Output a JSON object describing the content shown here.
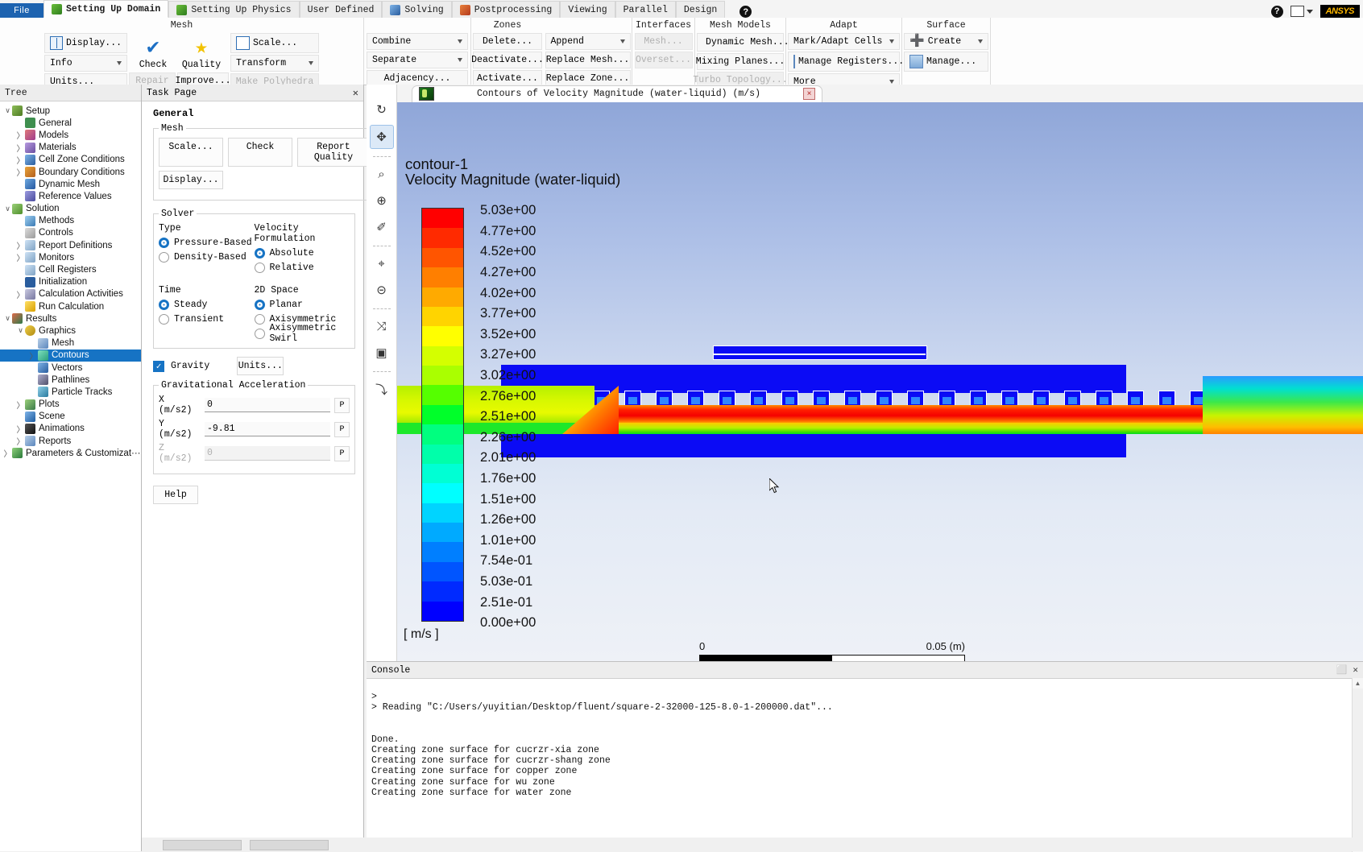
{
  "window": {
    "file_menu": "File",
    "tabs": [
      {
        "label": "Setting Up Domain",
        "icon": "green-mesh-icon",
        "active": true
      },
      {
        "label": "Setting Up Physics",
        "icon": "green-physics-icon",
        "active": false
      },
      {
        "label": "User Defined",
        "icon": "none",
        "active": false
      },
      {
        "label": "Solving",
        "icon": "blue-solver-icon",
        "active": false
      },
      {
        "label": "Postprocessing",
        "icon": "red-post-icon",
        "active": false
      },
      {
        "label": "Viewing",
        "icon": "none",
        "active": false
      },
      {
        "label": "Parallel",
        "icon": "none",
        "active": false
      },
      {
        "label": "Design",
        "icon": "none",
        "active": false
      }
    ],
    "help_label": "?",
    "brand": "ANSYS"
  },
  "ribbon": {
    "groups": [
      {
        "title": "Mesh",
        "items": [
          {
            "label": "Display...",
            "icon": "grid-icon",
            "disabled": false,
            "dropdown": false
          },
          {
            "label": "Info",
            "icon": "none",
            "disabled": false,
            "dropdown": true
          },
          {
            "label": "Units...",
            "icon": "none",
            "disabled": false,
            "dropdown": false
          },
          {
            "label": "Check",
            "icon": "blue-check-icon",
            "disabled": false,
            "big": true
          },
          {
            "label": "Repair",
            "icon": "none",
            "disabled": true,
            "dropdown": false
          },
          {
            "label": "Quality",
            "icon": "gold-star-icon",
            "disabled": false,
            "big": true
          },
          {
            "label": "Improve...",
            "icon": "none",
            "disabled": false,
            "dropdown": false
          },
          {
            "label": "Scale...",
            "icon": "scale-icon",
            "disabled": false,
            "dropdown": false
          },
          {
            "label": "Transform",
            "icon": "none",
            "disabled": false,
            "dropdown": true
          },
          {
            "label": "Make Polyhedra",
            "icon": "none",
            "disabled": true,
            "dropdown": false
          }
        ]
      },
      {
        "title": "Zones",
        "items": [
          {
            "label": "Combine",
            "icon": "none",
            "disabled": false,
            "dropdown": true
          },
          {
            "label": "Separate",
            "icon": "none",
            "disabled": false,
            "dropdown": true
          },
          {
            "label": "Adjacency...",
            "icon": "none",
            "disabled": false,
            "dropdown": false
          },
          {
            "label": "Delete...",
            "icon": "none",
            "disabled": false,
            "dropdown": false
          },
          {
            "label": "Deactivate...",
            "icon": "none",
            "disabled": false,
            "dropdown": false
          },
          {
            "label": "Activate...",
            "icon": "none",
            "disabled": false,
            "dropdown": false
          },
          {
            "label": "Append",
            "icon": "none",
            "disabled": false,
            "dropdown": true
          },
          {
            "label": "Replace Mesh...",
            "icon": "none",
            "disabled": false,
            "dropdown": false
          },
          {
            "label": "Replace Zone...",
            "icon": "none",
            "disabled": false,
            "dropdown": false
          }
        ]
      },
      {
        "title": "Interfaces",
        "items": [
          {
            "label": "Mesh...",
            "icon": "none",
            "disabled": true,
            "dropdown": false
          },
          {
            "label": "Overset...",
            "icon": "none",
            "disabled": true,
            "dropdown": false
          }
        ]
      },
      {
        "title": "Mesh Models",
        "items": [
          {
            "label": "Dynamic Mesh...",
            "icon": "dynamic-mesh-icon",
            "disabled": false,
            "dropdown": false
          },
          {
            "label": "Mixing Planes...",
            "icon": "none",
            "disabled": false,
            "dropdown": false
          },
          {
            "label": "Turbo Topology...",
            "icon": "none",
            "disabled": true,
            "dropdown": false
          }
        ]
      },
      {
        "title": "Adapt",
        "items": [
          {
            "label": "Mark/Adapt Cells",
            "icon": "none",
            "disabled": false,
            "dropdown": true
          },
          {
            "label": "Manage Registers...",
            "icon": "register-icon",
            "disabled": false,
            "dropdown": false
          },
          {
            "label": "More",
            "icon": "none",
            "disabled": false,
            "dropdown": true
          }
        ]
      },
      {
        "title": "Surface",
        "items": [
          {
            "label": "Create",
            "icon": "plus-icon",
            "disabled": false,
            "dropdown": true
          },
          {
            "label": "Manage...",
            "icon": "register-icon",
            "disabled": false,
            "dropdown": false
          }
        ]
      }
    ]
  },
  "tree": {
    "header": "Tree",
    "items": [
      {
        "label": "Setup",
        "indent": 0,
        "arrow": "down",
        "icon": "c-setup"
      },
      {
        "label": "General",
        "indent": 1,
        "arrow": "none",
        "icon": "c-general"
      },
      {
        "label": "Models",
        "indent": 1,
        "arrow": "right",
        "icon": "c-models"
      },
      {
        "label": "Materials",
        "indent": 1,
        "arrow": "right",
        "icon": "c-materials"
      },
      {
        "label": "Cell Zone Conditions",
        "indent": 1,
        "arrow": "right",
        "icon": "c-czc"
      },
      {
        "label": "Boundary Conditions",
        "indent": 1,
        "arrow": "right",
        "icon": "c-bc"
      },
      {
        "label": "Dynamic Mesh",
        "indent": 1,
        "arrow": "none",
        "icon": "c-dyn"
      },
      {
        "label": "Reference Values",
        "indent": 1,
        "arrow": "none",
        "icon": "c-ref"
      },
      {
        "label": "Solution",
        "indent": 0,
        "arrow": "down",
        "icon": "c-solution"
      },
      {
        "label": "Methods",
        "indent": 1,
        "arrow": "none",
        "icon": "c-methods"
      },
      {
        "label": "Controls",
        "indent": 1,
        "arrow": "none",
        "icon": "c-controls"
      },
      {
        "label": "Report Definitions",
        "indent": 1,
        "arrow": "right",
        "icon": "c-report"
      },
      {
        "label": "Monitors",
        "indent": 1,
        "arrow": "right",
        "icon": "c-report"
      },
      {
        "label": "Cell Registers",
        "indent": 1,
        "arrow": "none",
        "icon": "c-report"
      },
      {
        "label": "Initialization",
        "indent": 1,
        "arrow": "none",
        "icon": "c-init"
      },
      {
        "label": "Calculation Activities",
        "indent": 1,
        "arrow": "right",
        "icon": "c-calc"
      },
      {
        "label": "Run Calculation",
        "indent": 1,
        "arrow": "none",
        "icon": "c-run"
      },
      {
        "label": "Results",
        "indent": 0,
        "arrow": "down",
        "icon": "c-results"
      },
      {
        "label": "Graphics",
        "indent": 1,
        "arrow": "down",
        "icon": "c-graphics"
      },
      {
        "label": "Mesh",
        "indent": 2,
        "arrow": "none",
        "icon": "c-mesh"
      },
      {
        "label": "Contours",
        "indent": 2,
        "arrow": "right",
        "icon": "c-contours",
        "selected": true
      },
      {
        "label": "Vectors",
        "indent": 2,
        "arrow": "none",
        "icon": "c-vectors"
      },
      {
        "label": "Pathlines",
        "indent": 2,
        "arrow": "none",
        "icon": "c-path"
      },
      {
        "label": "Particle Tracks",
        "indent": 2,
        "arrow": "none",
        "icon": "c-part"
      },
      {
        "label": "Plots",
        "indent": 1,
        "arrow": "right",
        "icon": "c-plots"
      },
      {
        "label": "Scene",
        "indent": 1,
        "arrow": "none",
        "icon": "c-scene"
      },
      {
        "label": "Animations",
        "indent": 1,
        "arrow": "right",
        "icon": "c-anim"
      },
      {
        "label": "Reports",
        "indent": 1,
        "arrow": "right",
        "icon": "c-reports"
      },
      {
        "label": "Parameters & Customizat···",
        "indent": 0,
        "arrow": "right",
        "icon": "c-param"
      }
    ]
  },
  "task_page": {
    "header": "Task Page",
    "title": "General",
    "mesh_group": {
      "legend": "Mesh",
      "scale": "Scale...",
      "check": "Check",
      "report_quality": "Report Quality",
      "display": "Display..."
    },
    "solver_group": {
      "legend": "Solver",
      "type_label": "Type",
      "type_options": [
        "Pressure-Based",
        "Density-Based"
      ],
      "type_selected": "Pressure-Based",
      "velocity_label": "Velocity Formulation",
      "velocity_options": [
        "Absolute",
        "Relative"
      ],
      "velocity_selected": "Absolute",
      "time_label": "Time",
      "time_options": [
        "Steady",
        "Transient"
      ],
      "time_selected": "Steady",
      "space_label": "2D Space",
      "space_options": [
        "Planar",
        "Axisymmetric",
        "Axisymmetric Swirl"
      ],
      "space_selected": "Planar"
    },
    "gravity": {
      "label": "Gravity",
      "checked": true,
      "units_button": "Units...",
      "accel_legend": "Gravitational Acceleration",
      "rows": [
        {
          "label": "X (m/s2)",
          "value": "0",
          "disabled": false,
          "p": "P"
        },
        {
          "label": "Y (m/s2)",
          "value": "-9.81",
          "disabled": false,
          "p": "P"
        },
        {
          "label": "Z (m/s2)",
          "value": "0",
          "disabled": true,
          "p": "P"
        }
      ]
    },
    "help_button": "Help"
  },
  "graphics_toolbar": {
    "icons": [
      {
        "name": "refresh-icon",
        "glyph": "↻",
        "active": false
      },
      {
        "name": "pan-move-icon",
        "glyph": "✥",
        "active": true
      },
      {
        "name": "zoom-fit-icon",
        "glyph": "⌕",
        "active": false
      },
      {
        "name": "zoom-in-icon",
        "glyph": "⊕",
        "active": false
      },
      {
        "name": "probe-icon",
        "glyph": "✐",
        "active": false
      },
      {
        "name": "zoom-region-icon",
        "glyph": "⌖",
        "active": false
      },
      {
        "name": "zoom-out-icon",
        "glyph": "⊝",
        "active": false
      },
      {
        "name": "mesh-display-icon",
        "glyph": "⤨",
        "active": false
      },
      {
        "name": "camera-icon",
        "glyph": "▣",
        "active": false
      },
      {
        "name": "axes-icon",
        "glyph": "⤵",
        "active": false
      }
    ]
  },
  "graphics_window": {
    "tab_title": "Contours of Velocity Magnitude  (water-liquid)  (m/s)",
    "close_label": "×",
    "overlay_title": "contour-1",
    "overlay_subtitle": "Velocity Magnitude (water-liquid)",
    "unit_label": "[ m/s ]",
    "scale": {
      "left": "0",
      "right": "0.05 (m)",
      "filled_fraction": 0.5
    }
  },
  "chart_data": {
    "type": "heatmap",
    "title": "Contours of Velocity Magnitude (water-liquid) (m/s)",
    "subtitle": "contour-1 / Velocity Magnitude (water-liquid)",
    "units": "[ m/s ]",
    "colormap": "rainbow-jet",
    "legend_position": "left",
    "value_range": [
      0.0,
      5.03
    ],
    "legend_values": [
      "5.03e+00",
      "4.77e+00",
      "4.52e+00",
      "4.27e+00",
      "4.02e+00",
      "3.77e+00",
      "3.52e+00",
      "3.27e+00",
      "3.02e+00",
      "2.76e+00",
      "2.51e+00",
      "2.26e+00",
      "2.01e+00",
      "1.76e+00",
      "1.51e+00",
      "1.26e+00",
      "1.01e+00",
      "7.54e-01",
      "5.03e-01",
      "2.51e-01",
      "0.00e+00"
    ],
    "legend_numeric": [
      5.03,
      4.77,
      4.52,
      4.27,
      4.02,
      3.77,
      3.52,
      3.27,
      3.02,
      2.76,
      2.51,
      2.26,
      2.01,
      1.76,
      1.51,
      1.26,
      1.01,
      0.754,
      0.503,
      0.251,
      0.0
    ],
    "colorbar_colors": [
      "#ff0000",
      "#ff2a00",
      "#ff5500",
      "#ff7f00",
      "#ffaa00",
      "#ffd400",
      "#ffff00",
      "#d4ff00",
      "#aaff00",
      "#55ff00",
      "#00ff2a",
      "#00ff7f",
      "#00ffaa",
      "#00ffd4",
      "#00ffff",
      "#00d4ff",
      "#00aaff",
      "#007fff",
      "#0055ff",
      "#002aff",
      "#0000ff"
    ],
    "xaxis_scale_bar": {
      "min": "0",
      "max": "0.05 (m)"
    },
    "description": "2D planar microchannel with 20 rectangular fins; high velocity jet (red ~4.5 m/s) below fin array, blue solid copper/water zones above"
  },
  "console": {
    "header": "Console",
    "lines": [
      ">",
      "> Reading \"C:/Users/yuyitian/Desktop/fluent/square-2-32000-125-8.0-1-200000.dat\"...",
      "",
      "",
      "Done.",
      "Creating zone surface for cucrzr-xia zone",
      "Creating zone surface for cucrzr-shang zone",
      "Creating zone surface for copper zone",
      "Creating zone surface for wu zone",
      "Creating zone surface for water zone"
    ]
  }
}
